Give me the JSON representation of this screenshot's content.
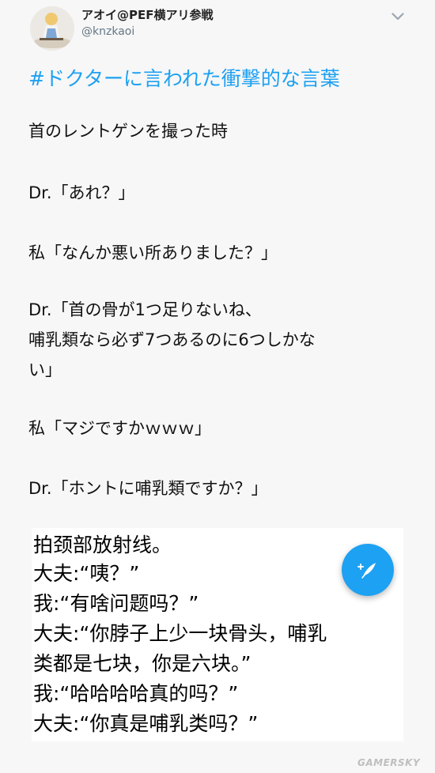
{
  "header": {
    "display_name": "アオイ@PEF横アリ参戦",
    "handle": "@knzkaoi"
  },
  "tweet": {
    "hashtag": "#ドクターに言われた衝撃的な言葉",
    "lines": [
      "首のレントゲンを撮った時",
      "Dr.「あれ？」",
      "私「なんか悪い所ありました？」",
      "Dr.「首の骨が1つ足りないね、",
      "哺乳類なら必ず7つあるのに6つしかな",
      "い」",
      "私「マジですかｗｗｗ」",
      "Dr.「ホントに哺乳類ですか？」"
    ]
  },
  "translation": {
    "lines": [
      "拍颈部放射线。",
      "大夫:“咦？”",
      "我:“有啥问题吗？”",
      "大夫:“你脖子上少一块骨头，哺乳",
      "类都是七块，你是六块。”",
      "我:“哈哈哈哈真的吗？”",
      "大夫:“你真是哺乳类吗？”"
    ]
  },
  "compose": {
    "icon": "compose-feather-icon"
  },
  "watermark": "GAMERSKY",
  "colors": {
    "accent": "#1da1f2",
    "handle": "#657786"
  }
}
